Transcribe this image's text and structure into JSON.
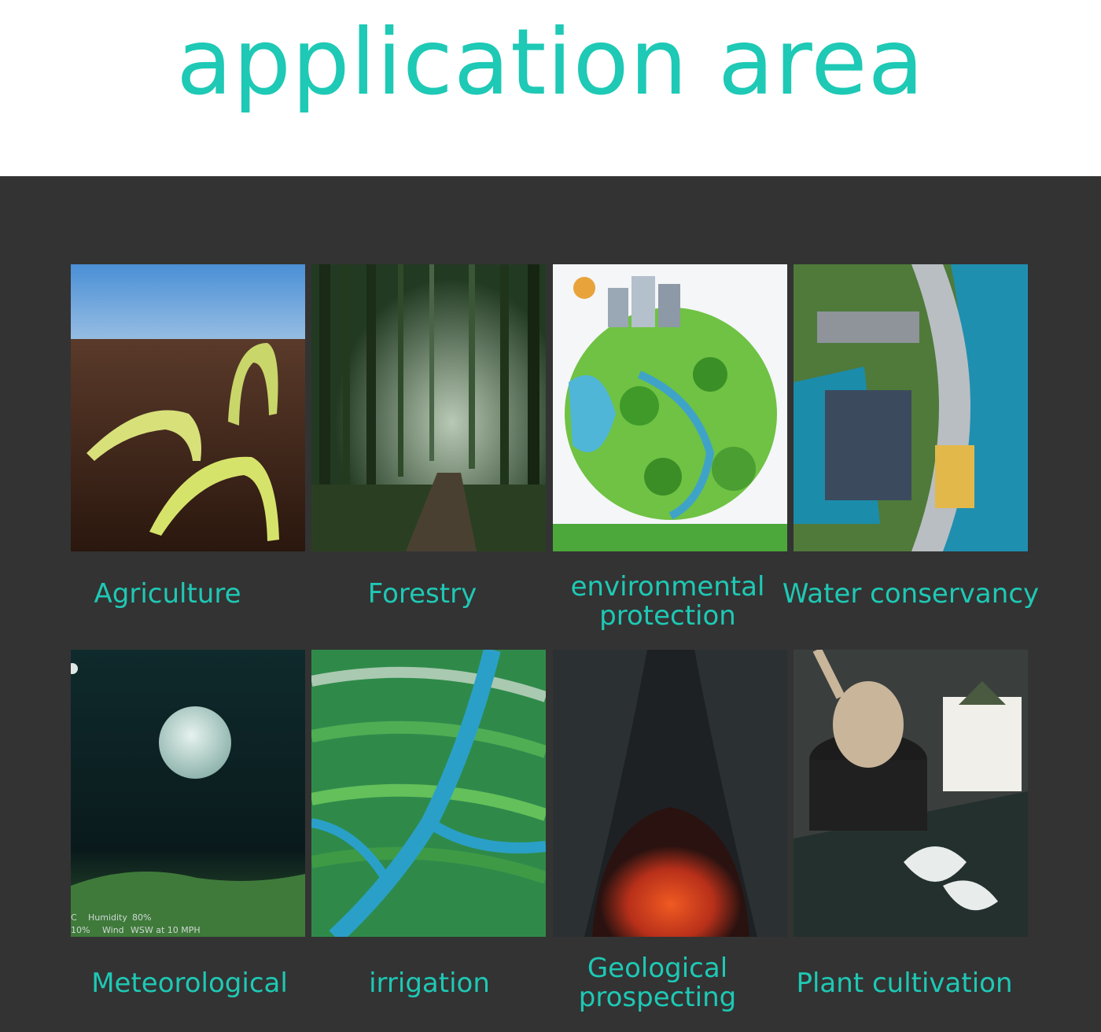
{
  "header": {
    "title": "application area"
  },
  "accent_color": "#1ec9b5",
  "panel_color": "#333333",
  "row1": [
    {
      "icon": "seedling-photo",
      "lines": [
        "Agriculture"
      ]
    },
    {
      "icon": "forest-photo",
      "lines": [
        "Forestry"
      ]
    },
    {
      "icon": "green-globe-illustration",
      "lines": [
        "environmental",
        "protection"
      ]
    },
    {
      "icon": "hydropower-dam-photo",
      "lines": [
        "Water conservancy"
      ]
    }
  ],
  "row2": [
    {
      "icon": "moon-night-weather-photo",
      "lines": [
        "Meteorological"
      ],
      "overlay": {
        "humidity_label": "Humidity",
        "humidity_value": "80%",
        "left_value": "10%",
        "wind_label": "Wind",
        "wind_value": "WSW at 10 MPH",
        "left_glyph": "C"
      }
    },
    {
      "icon": "river-fields-illustration",
      "lines": [
        "irrigation"
      ]
    },
    {
      "icon": "lava-cave-photo",
      "lines": [
        "Geological",
        "prospecting"
      ]
    },
    {
      "icon": "potted-plants-photo",
      "lines": [
        "Plant cultivation"
      ]
    }
  ]
}
